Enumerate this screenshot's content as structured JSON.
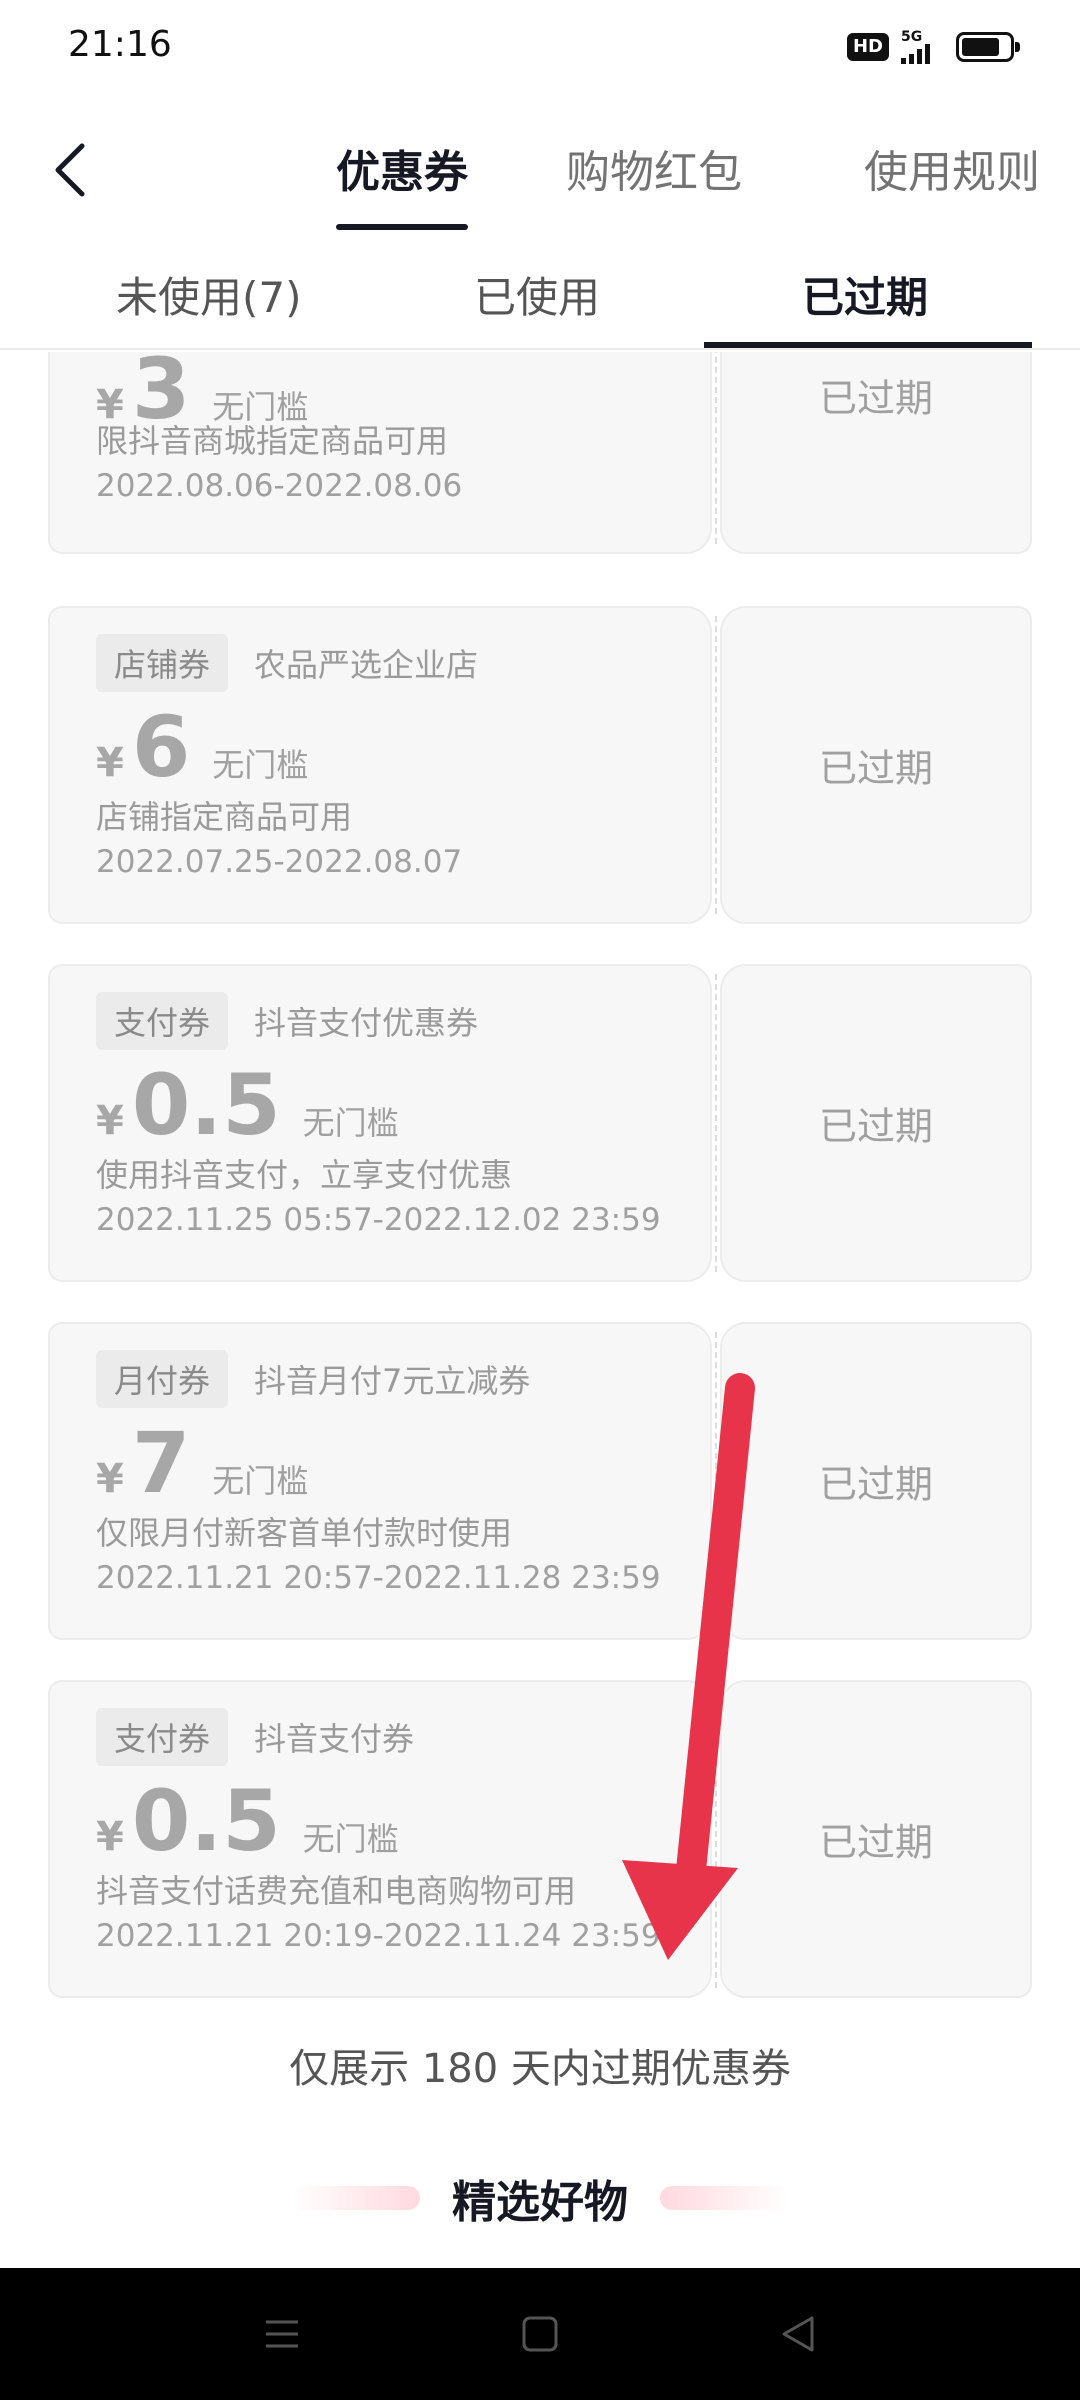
{
  "status_bar": {
    "time": "21:16",
    "hd": "HD",
    "network": "5G",
    "battery_level": 0.8
  },
  "top_nav": {
    "back_icon": "chevron-left-icon",
    "tabs": [
      {
        "label": "优惠券",
        "active": true
      },
      {
        "label": "购物红包",
        "active": false
      },
      {
        "label": "使用规则",
        "active": false
      }
    ]
  },
  "sub_tabs": [
    {
      "label": "未使用(7)",
      "active": false
    },
    {
      "label": "已使用",
      "active": false
    },
    {
      "label": "已过期",
      "active": true
    }
  ],
  "coupons": [
    {
      "tag": "",
      "shop": "",
      "currency": "¥",
      "value": "3",
      "threshold": "无门槛",
      "desc": "限抖音商城指定商品可用",
      "period": "2022.08.06-2022.08.06",
      "status": "已过期"
    },
    {
      "tag": "店铺券",
      "shop": "农品严选企业店",
      "currency": "¥",
      "value": "6",
      "threshold": "无门槛",
      "desc": "店铺指定商品可用",
      "period": "2022.07.25-2022.08.07",
      "status": "已过期"
    },
    {
      "tag": "支付券",
      "shop": "抖音支付优惠券",
      "currency": "¥",
      "value": "0.5",
      "threshold": "无门槛",
      "desc": "使用抖音支付，立享支付优惠",
      "period": "2022.11.25 05:57-2022.12.02 23:59",
      "status": "已过期"
    },
    {
      "tag": "月付券",
      "shop": "抖音月付7元立减券",
      "currency": "¥",
      "value": "7",
      "threshold": "无门槛",
      "desc": "仅限月付新客首单付款时使用",
      "period": "2022.11.21 20:57-2022.11.28 23:59",
      "status": "已过期"
    },
    {
      "tag": "支付券",
      "shop": "抖音支付券",
      "currency": "¥",
      "value": "0.5",
      "threshold": "无门槛",
      "desc": "抖音支付话费充值和电商购物可用",
      "period": "2022.11.21 20:19-2022.11.24 23:59",
      "status": "已过期"
    }
  ],
  "notice": "仅展示 180 天内过期优惠券",
  "picks_title": "精选好物",
  "colors": {
    "accent": "#161823",
    "arrow": "#e8344a",
    "card_bg": "#f7f7f7"
  },
  "android_nav": {
    "menu_icon": "menu-icon",
    "home_icon": "home-square-icon",
    "back_icon": "back-triangle-icon"
  }
}
